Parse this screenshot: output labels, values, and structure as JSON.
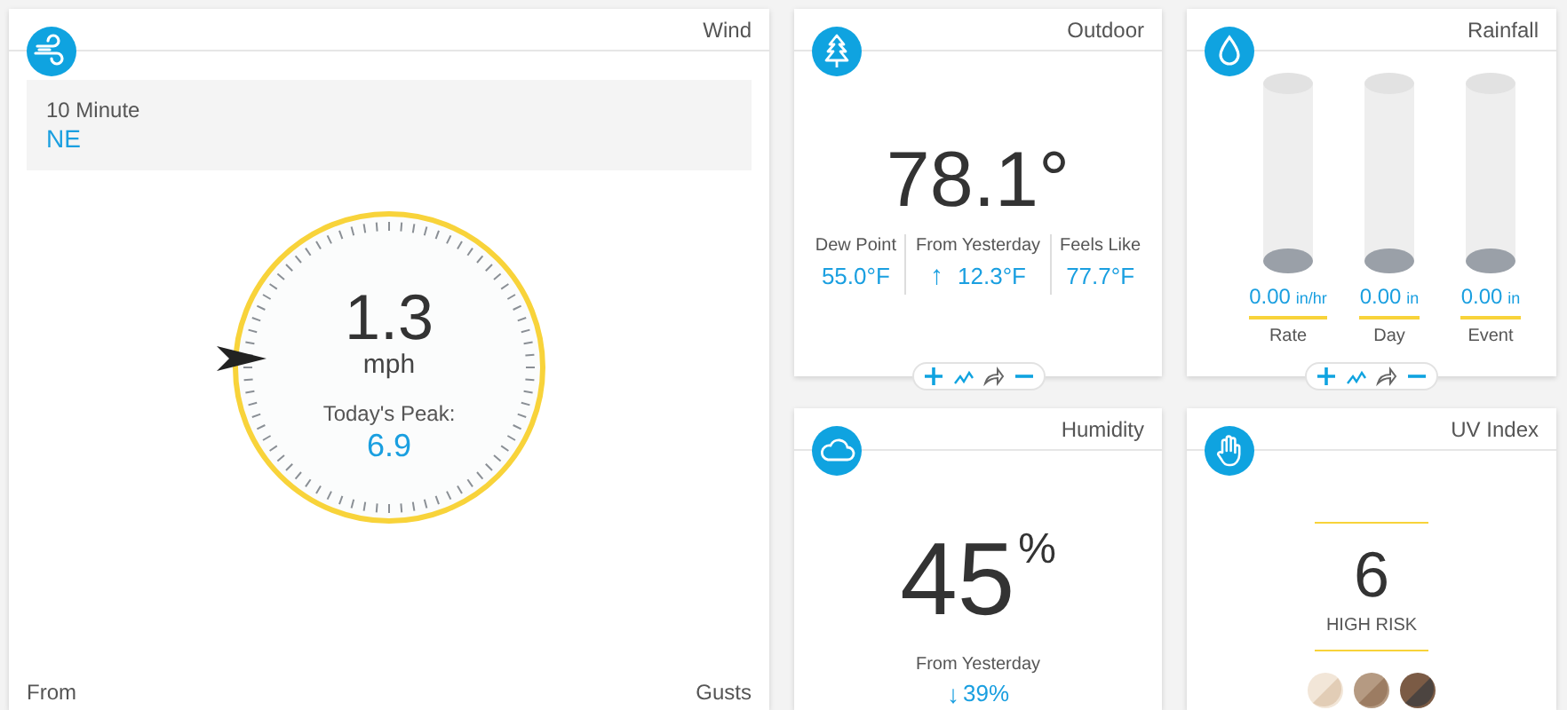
{
  "wind": {
    "title": "Wind",
    "period": {
      "label": "10 Minute",
      "value": "NE"
    },
    "speed": "1.3",
    "unit": "mph",
    "peak_label": "Today's Peak:",
    "peak": "6.9",
    "bottom_left": "From",
    "bottom_right": "Gusts"
  },
  "outdoor": {
    "title": "Outdoor",
    "temperature": "78.1°",
    "stats": [
      {
        "label": "Dew Point",
        "value": "55.0°F"
      },
      {
        "label": "From Yesterday",
        "arrow": "↑",
        "value": "12.3°F"
      },
      {
        "label": "Feels Like",
        "value": "77.7°F"
      }
    ]
  },
  "rainfall": {
    "title": "Rainfall",
    "gauges": [
      {
        "value": "0.00",
        "unit": "in/hr",
        "label": "Rate"
      },
      {
        "value": "0.00",
        "unit": "in",
        "label": "Day"
      },
      {
        "value": "0.00",
        "unit": "in",
        "label": "Event"
      }
    ]
  },
  "humidity": {
    "title": "Humidity",
    "value": "45",
    "unit": "%",
    "change_label": "From Yesterday",
    "arrow": "↓",
    "change": "39%"
  },
  "uv_index": {
    "title": "UV Index",
    "value": "6",
    "risk": "HIGH RISK"
  }
}
